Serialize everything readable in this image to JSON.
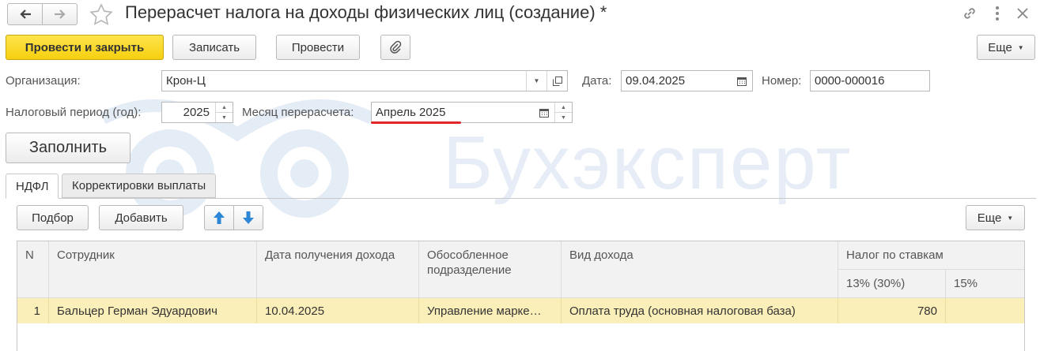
{
  "window": {
    "title": "Перерасчет налога на доходы физических лиц (создание) *"
  },
  "toolbar": {
    "post_close": "Провести и закрыть",
    "save": "Записать",
    "post": "Провести",
    "more": "Еще"
  },
  "form": {
    "org_label": "Организация:",
    "org_value": "Крон-Ц",
    "date_label": "Дата:",
    "date_value": "09.04.2025",
    "number_label": "Номер:",
    "number_value": "0000-000016",
    "period_label": "Налоговый период (год):",
    "period_value": "2025",
    "month_label": "Месяц перерасчета:",
    "month_value": "Апрель 2025",
    "fill_button": "Заполнить"
  },
  "watermark": {
    "text": "Бухэксперт",
    "color": "#e6edf6"
  },
  "tabs": [
    {
      "label": "НДФЛ",
      "active": true
    },
    {
      "label": "Корректировки выплаты",
      "active": false
    }
  ],
  "table_toolbar": {
    "pick": "Подбор",
    "add": "Добавить",
    "more": "Еще"
  },
  "table": {
    "headers": {
      "n": "N",
      "employee": "Сотрудник",
      "income_date": "Дата получения дохода",
      "division": "Обособленное подразделение",
      "income_type": "Вид дохода",
      "tax_by_rates": "Налог по ставкам",
      "rate_13": "13% (30%)",
      "rate_15": "15%"
    },
    "rows": [
      {
        "n": "1",
        "employee": "Бальцер Герман Эдуардович",
        "income_date": "10.04.2025",
        "division": "Управление марке…",
        "income_type": "Оплата труда (основная налоговая база)",
        "rate_13": "780",
        "rate_15": ""
      }
    ]
  },
  "colors": {
    "primary_button": "#f6cf0f",
    "selected_row": "#fbefb9",
    "underline": "#e0262b",
    "arrow_blue": "#2e86d6"
  }
}
